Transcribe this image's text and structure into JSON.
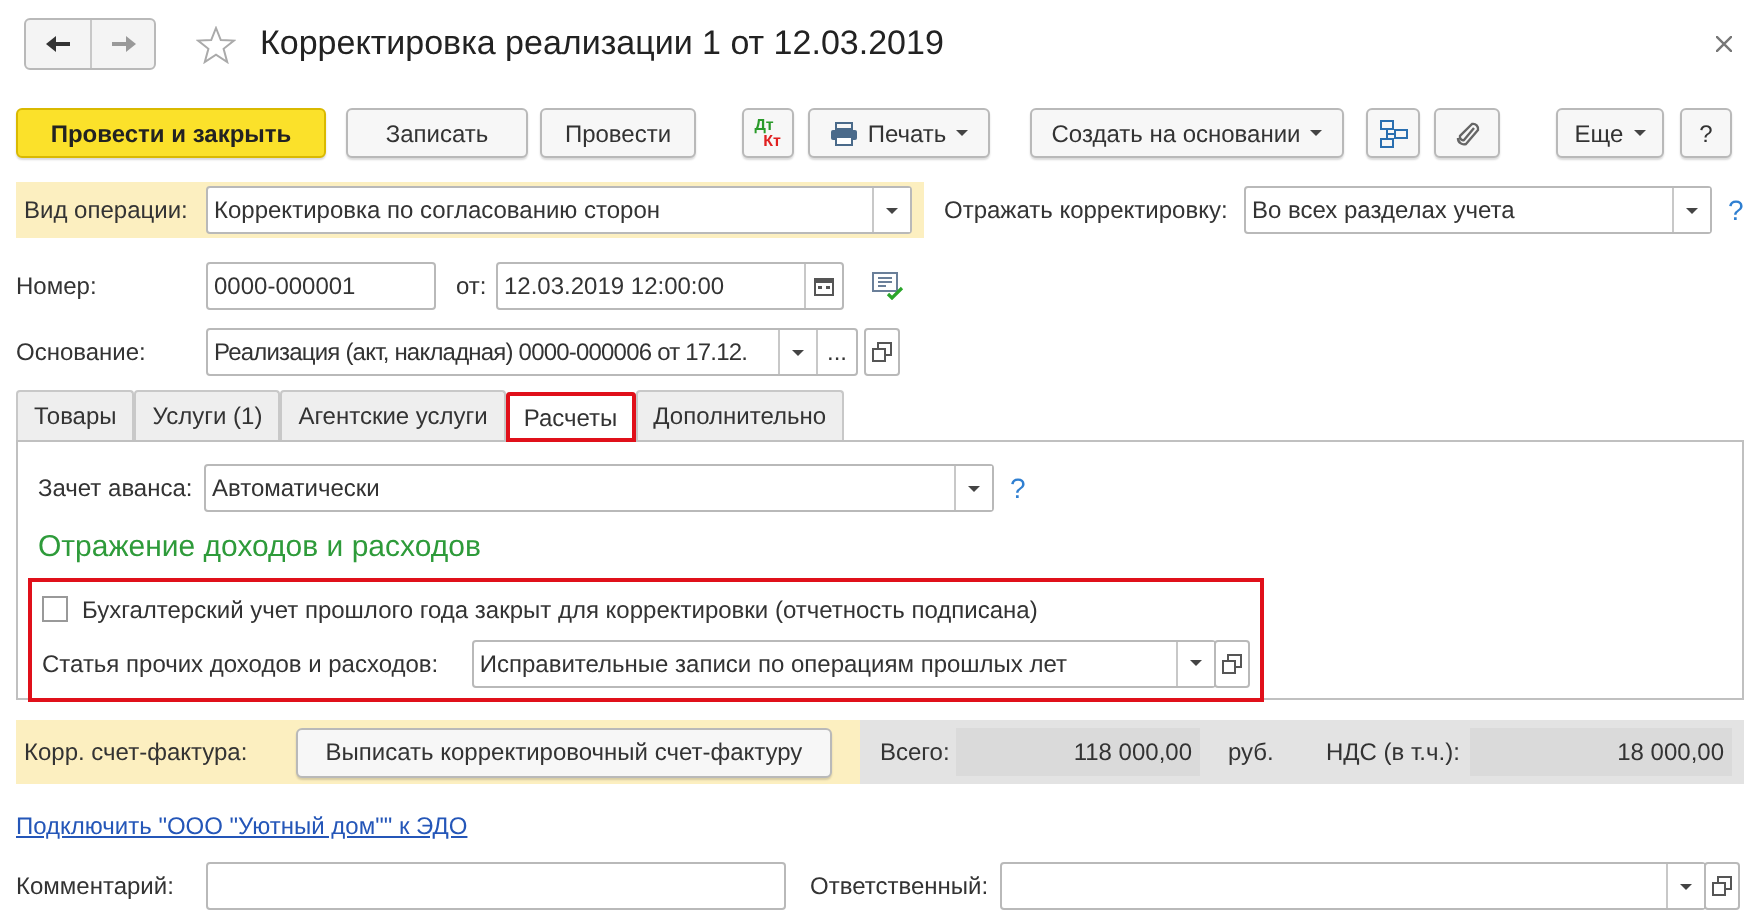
{
  "window": {
    "title": "Корректировка реализации 1 от 12.03.2019",
    "favorite": false
  },
  "nav": [
    {
      "kind": "back",
      "disabled": false
    },
    {
      "kind": "forward",
      "disabled": true
    }
  ],
  "toolbar": [
    {
      "kind": "primary",
      "label": "Провести и закрыть"
    },
    {
      "kind": "button",
      "label": "Записать"
    },
    {
      "kind": "button",
      "label": "Провести"
    },
    {
      "kind": "dtkt",
      "label": "Дт",
      "label2": "Кт"
    },
    {
      "kind": "print",
      "label": "Печать"
    },
    {
      "kind": "menu",
      "label": "Создать на основании"
    },
    {
      "kind": "structure"
    },
    {
      "kind": "attach"
    },
    {
      "kind": "menu",
      "label": "Еще"
    },
    {
      "kind": "button",
      "label": "?"
    }
  ],
  "operation": {
    "label": "Вид операции:",
    "value": "Корректировка по согласованию сторон"
  },
  "reflect": {
    "label": "Отражать корректировку:",
    "value": "Во всех разделах учета",
    "help": "?"
  },
  "number": {
    "label": "Номер:",
    "value": "0000-000001"
  },
  "date": {
    "label": "от:",
    "value": "12.03.2019 12:00:00"
  },
  "basis": {
    "label": "Основание:",
    "value": "Реализация (акт, накладная) 0000-000006 от 17.12.",
    "more": "..."
  },
  "tabs": [
    {
      "label": "Товары",
      "selected": false,
      "highlighted": false
    },
    {
      "label": "Услуги (1)",
      "selected": false,
      "highlighted": false
    },
    {
      "label": "Агентские услуги",
      "selected": false,
      "highlighted": false
    },
    {
      "label": "Расчеты",
      "selected": true,
      "highlighted": true
    },
    {
      "label": "Дополнительно",
      "selected": false,
      "highlighted": false
    }
  ],
  "advance": {
    "label": "Зачет аванса:",
    "value": "Автоматически",
    "help": "?"
  },
  "section": {
    "heading": "Отражение доходов и расходов",
    "highlighted": true,
    "checkbox": {
      "label": "Бухгалтерский учет прошлого года закрыт для корректировки (отчетность подписана)",
      "checked": false
    },
    "article": {
      "label": "Статья прочих доходов и расходов:",
      "value": "Исправительные записи по операциям прошлых лет"
    }
  },
  "invoice": {
    "label": "Корр. счет-фактура:",
    "button": "Выписать корректировочный счет-фактуру"
  },
  "totals": {
    "total_label": "Всего:",
    "total": "118 000,00",
    "currency": "руб.",
    "vat_label": "НДС (в т.ч.):",
    "vat": "18 000,00"
  },
  "link": "Подключить \"ООО \"Уютный дом\"\" к ЭДО",
  "comment": {
    "label": "Комментарий:"
  },
  "responsible": {
    "label": "Ответственный:"
  }
}
